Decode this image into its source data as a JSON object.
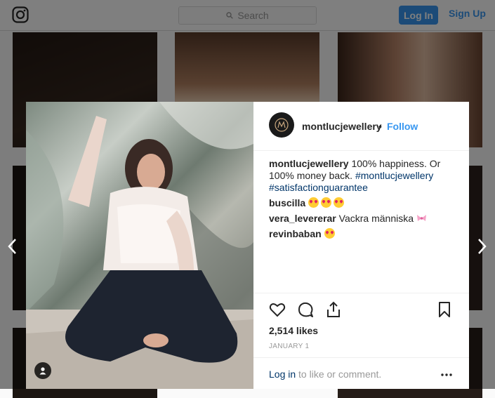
{
  "nav": {
    "search_placeholder": "Search",
    "login_label": "Log In",
    "signup_label": "Sign Up",
    "logo_icon": "instagram-icon"
  },
  "post": {
    "username": "montlucjewellery",
    "separator": "•",
    "follow_label": "Follow",
    "caption": {
      "username": "montlucjewellery",
      "text": " 100% happiness. Or 100% money back. ",
      "hashtag1": "#montlucjewellery",
      "hashtag2": "#satisfactionguarantee"
    },
    "comments": [
      {
        "username": "buscilla",
        "text": "",
        "emoji_count": 3,
        "emoji": "heart-eyes"
      },
      {
        "username": "vera_levererar",
        "text": " Vackra människa ",
        "emoji": "ribbon"
      },
      {
        "username": "revinbaban",
        "text": " ",
        "emoji_count": 1,
        "emoji": "heart-eyes"
      }
    ],
    "likes": "2,514 likes",
    "date": "JANUARY 1",
    "footer": {
      "login_link": "Log in",
      "login_text": " to like or comment."
    }
  },
  "colors": {
    "accent": "#3897f0",
    "hashtag": "#003569",
    "muted": "#999999"
  }
}
